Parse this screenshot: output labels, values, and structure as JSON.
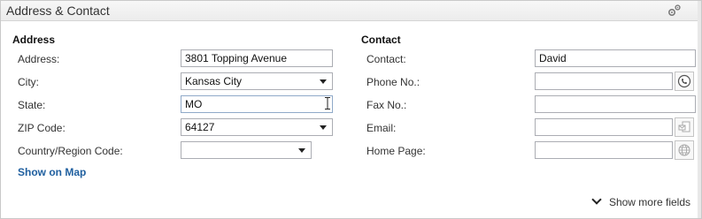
{
  "panel": {
    "title": "Address & Contact",
    "settings_icon": "gear-icon"
  },
  "address": {
    "section_title": "Address",
    "fields": {
      "address": {
        "label": "Address:",
        "value": "3801 Topping Avenue"
      },
      "city": {
        "label": "City:",
        "value": "Kansas City"
      },
      "state": {
        "label": "State:",
        "value": "MO"
      },
      "zip": {
        "label": "ZIP Code:",
        "value": "64127"
      },
      "country": {
        "label": "Country/Region Code:",
        "value": ""
      }
    },
    "show_on_map": "Show on Map"
  },
  "contact": {
    "section_title": "Contact",
    "fields": {
      "contact": {
        "label": "Contact:",
        "value": "David"
      },
      "phone": {
        "label": "Phone No.:",
        "value": "",
        "button_icon": "phone-icon"
      },
      "fax": {
        "label": "Fax No.:",
        "value": ""
      },
      "email": {
        "label": "Email:",
        "value": "",
        "button_icon": "email-icon"
      },
      "home_page": {
        "label": "Home Page:",
        "value": "",
        "button_icon": "globe-icon"
      }
    }
  },
  "footer": {
    "show_more": "Show more fields"
  }
}
